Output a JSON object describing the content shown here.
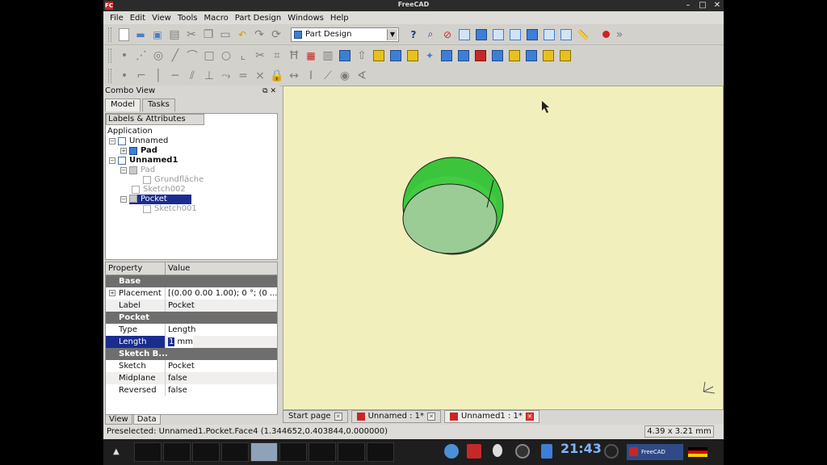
{
  "window": {
    "title": "FreeCAD",
    "logo": "FC"
  },
  "menu": [
    "File",
    "Edit",
    "View",
    "Tools",
    "Macro",
    "Part Design",
    "Windows",
    "Help"
  ],
  "toolbar": {
    "workbench": "Part Design"
  },
  "combo": {
    "title": "Combo View",
    "tabs": [
      "Model",
      "Tasks"
    ],
    "tree_header": "Labels & Attributes",
    "tree": [
      {
        "label": "Application"
      },
      {
        "label": "Unnamed"
      },
      {
        "label": "Pad"
      },
      {
        "label": "Unnamed1"
      },
      {
        "label": "Pad"
      },
      {
        "label": "Grundfläche"
      },
      {
        "label": "Sketch002"
      },
      {
        "label": "Pocket"
      },
      {
        "label": "Sketch001"
      }
    ],
    "prop_header": {
      "property": "Property",
      "value": "Value"
    },
    "props": {
      "base_group": "Base",
      "placement_key": "Placement",
      "placement_val": "[(0.00 0.00 1.00); 0 °; (0 ...",
      "label_key": "Label",
      "label_val": "Pocket",
      "pocket_group": "Pocket",
      "type_key": "Type",
      "type_val": "Length",
      "length_key": "Length",
      "length_num": "1",
      "length_unit": " mm",
      "sketch_group": "Sketch B...",
      "sketch_key": "Sketch",
      "sketch_val": "Pocket",
      "midplane_key": "Midplane",
      "midplane_val": "false",
      "reversed_key": "Reversed",
      "reversed_val": "false"
    },
    "bottom_tabs": [
      "View",
      "Data"
    ]
  },
  "doc_tabs": [
    "Start page",
    "Unnamed : 1*",
    "Unnamed1 : 1*"
  ],
  "status": {
    "text": "Preselected: Unnamed1.Pocket.Face4 (1.344652,0.403844,0.000000)",
    "dims": "4.39 x 3.21 mm"
  },
  "taskbar": {
    "clock": "21:43",
    "app": "FreeCAD"
  },
  "colors": {
    "viewport_bg": "#f1f0bd",
    "cylinder_side": "#3cc43c",
    "cylinder_top": "#9ccc96",
    "selection": "#1a2d8f"
  }
}
